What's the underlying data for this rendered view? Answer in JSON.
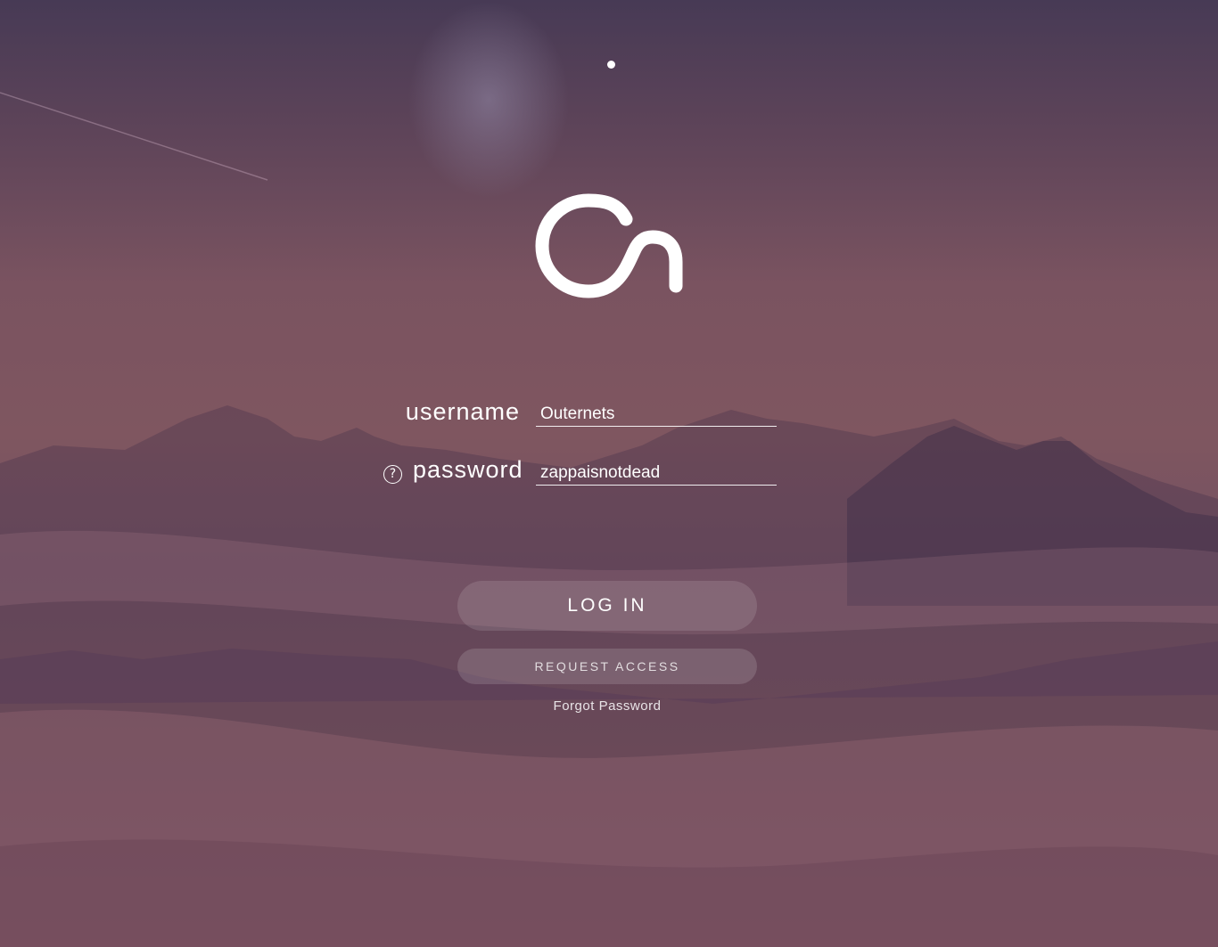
{
  "status": {
    "indicator_icon": "dot-icon"
  },
  "brand": {
    "logo_icon": "outernet-on-logo-icon"
  },
  "login_form": {
    "username_label": "username",
    "username_value": "Outernets",
    "password_label": "password",
    "password_value": "zappaisnotdead",
    "password_help_icon": "question-circle-icon",
    "password_help_glyph": "?"
  },
  "actions": {
    "login_label": "LOG IN",
    "request_access_label": "REQUEST ACCESS",
    "forgot_password_label": "Forgot Password"
  },
  "colors": {
    "text": "#ffffff",
    "background_top": "#473a55",
    "background_mid": "#7f5660",
    "background_bottom": "#8a5d66"
  }
}
